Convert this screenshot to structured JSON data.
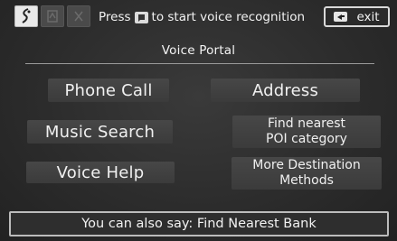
{
  "header": {
    "hint_before": "Press",
    "hint_after": "to start voice recognition",
    "exit_label": "exit"
  },
  "title": "Voice Portal",
  "commands": {
    "phone_call": "Phone Call",
    "address": "Address",
    "music_search": "Music Search",
    "find_poi_line1": "Find nearest",
    "find_poi_line2": "POI category",
    "voice_help": "Voice Help",
    "more_dest_line1": "More Destination",
    "more_dest_line2": "Methods"
  },
  "footer": {
    "prompt": "You can also say: Find Nearest Bank"
  },
  "icons": {
    "ptt_active": "talk-icon",
    "ptt_dim_1": "talk-icon-dim",
    "ptt_dim_2": "talk-icon-dim",
    "hint_badge": "talk-button-icon",
    "exit": "back-icon"
  },
  "colors": {
    "background": "#2c2c2c",
    "button": "#434343",
    "text": "#f0f0f0",
    "border": "#d9d9d9"
  }
}
